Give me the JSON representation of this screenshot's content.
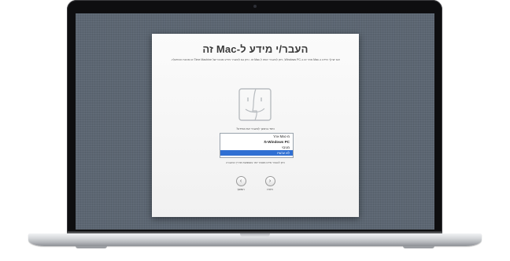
{
  "window": {
    "title": "העבר/י מידע ל-Mac זה",
    "subtitle": "אם יש לך מידע ב-Mac אחר או ב-Windows PC, ניתן להעביר אותו ל-Mac זה. ניתן גם להעביר מידע מגיבוי של Time Machine או מכונת ההפעלה.",
    "prompt": "כיצד ברצונך להעביר את המידע?",
    "options": [
      {
        "label": "מ-Mac אחר",
        "selected": false
      },
      {
        "label": "Windows PC-מ",
        "selected": false
      },
      {
        "label": "מגיבוי",
        "selected": false
      },
      {
        "label": "לא עכשיו",
        "selected": true
      }
    ],
    "note": "ניתן להעביר מידע מאוחר יותר באמצעות מדריך ההעברה",
    "buttons": {
      "continue": "המשך",
      "back": "חזרה"
    }
  },
  "icons": {
    "finder": "finder-icon",
    "continue": "chevron-right-icon",
    "back": "chevron-left-icon"
  },
  "colors": {
    "selection": "#2f6fd3",
    "desktop": "#5c6672"
  }
}
